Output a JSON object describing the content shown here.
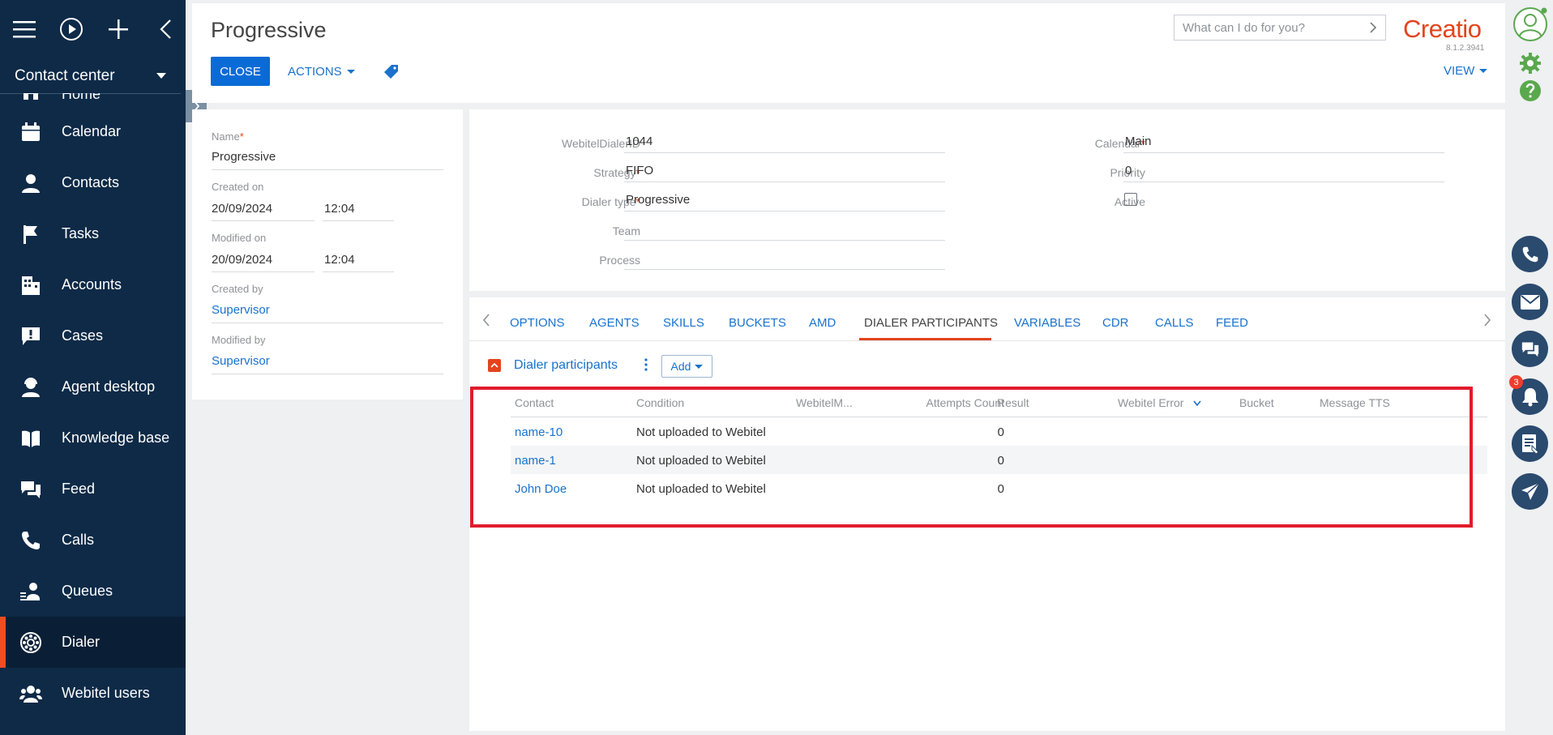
{
  "sidebar": {
    "workspace": "Contact center",
    "items": [
      {
        "label": "Home",
        "icon": "home-icon"
      },
      {
        "label": "Calendar",
        "icon": "calendar-icon"
      },
      {
        "label": "Contacts",
        "icon": "contact-icon"
      },
      {
        "label": "Tasks",
        "icon": "flag-icon"
      },
      {
        "label": "Accounts",
        "icon": "building-icon"
      },
      {
        "label": "Cases",
        "icon": "alert-bubble-icon"
      },
      {
        "label": "Agent desktop",
        "icon": "agent-icon"
      },
      {
        "label": "Knowledge base",
        "icon": "book-icon"
      },
      {
        "label": "Feed",
        "icon": "chat-icon"
      },
      {
        "label": "Calls",
        "icon": "phone-icon"
      },
      {
        "label": "Queues",
        "icon": "queue-icon"
      },
      {
        "label": "Dialer",
        "icon": "dialer-icon"
      },
      {
        "label": "Webitel users",
        "icon": "users-icon"
      }
    ],
    "active_item": "Dialer"
  },
  "header": {
    "title": "Progressive",
    "close_label": "CLOSE",
    "actions_label": "ACTIONS",
    "search_placeholder": "What can I do for you?",
    "logo": "Creatio",
    "version": "8.1.2.3941",
    "view_label": "VIEW"
  },
  "left_form": {
    "name_label": "Name",
    "name_value": "Progressive",
    "created_on_label": "Created on",
    "created_on_date": "20/09/2024",
    "created_on_time": "12:04",
    "modified_on_label": "Modified on",
    "modified_on_date": "20/09/2024",
    "modified_on_time": "12:04",
    "created_by_label": "Created by",
    "created_by_value": "Supervisor",
    "modified_by_label": "Modified by",
    "modified_by_value": "Supervisor"
  },
  "main_form": {
    "dialer_id_label": "WebitelDialerID",
    "dialer_id_value": "1044",
    "strategy_label": "Strategy",
    "strategy_value": "FIFO",
    "dialer_type_label": "Dialer type",
    "dialer_type_value": "Progressive",
    "team_label": "Team",
    "team_value": "",
    "process_label": "Process",
    "process_value": "",
    "calendar_label": "Calendar",
    "calendar_value": "Main",
    "priority_label": "Priority",
    "priority_value": "0",
    "active_label": "Active",
    "active_checked": false
  },
  "tabs": [
    "OPTIONS",
    "AGENTS",
    "SKILLS",
    "BUCKETS",
    "AMD",
    "DIALER PARTICIPANTS",
    "VARIABLES",
    "CDR",
    "CALLS",
    "FEED"
  ],
  "active_tab": "DIALER PARTICIPANTS",
  "detail": {
    "title": "Dialer participants",
    "add_label": "Add",
    "columns": [
      "Contact",
      "Condition",
      "WebitelM...",
      "Attempts Count",
      "Result",
      "Webitel Error",
      "Bucket",
      "Message TTS"
    ],
    "rows": [
      {
        "contact": "name-10",
        "condition": "Not uploaded to Webitel",
        "attempts": "0"
      },
      {
        "contact": "name-1",
        "condition": "Not uploaded to Webitel",
        "attempts": "0"
      },
      {
        "contact": "John Doe",
        "condition": "Not uploaded to Webitel",
        "attempts": "0"
      }
    ]
  },
  "notifications_count": "3",
  "colors": {
    "accent": "#e3441d",
    "primary": "#0a6bd6",
    "sidebar": "#0e2a47",
    "highlight": "#e11b2b"
  }
}
